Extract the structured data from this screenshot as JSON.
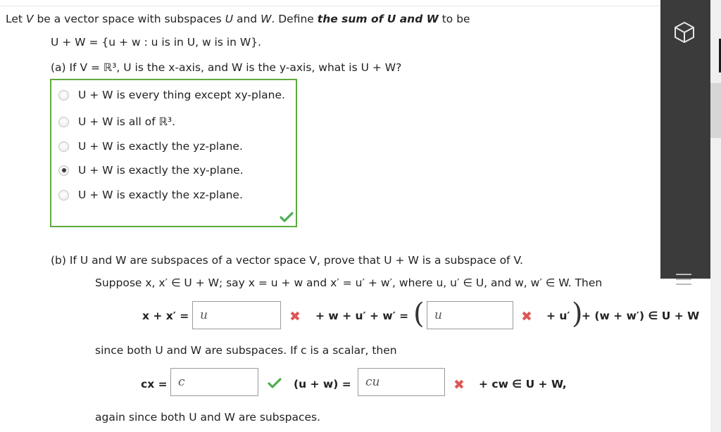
{
  "intro": {
    "prefix": "Let ",
    "V": "V",
    "mid1": " be a vector space with subspaces ",
    "U": "U",
    "and": " and ",
    "W": "W",
    "mid2": ". Define ",
    "bold_def": "the sum of U and W",
    "suffix": " to be"
  },
  "sum_def": "U + W = {u + w : u is in U, w is in W}.",
  "part_a": {
    "question": "(a) If V = ℝ³, U is the x-axis, and W is the y-axis, what is U + W?",
    "options": [
      {
        "label": "U + W is every thing except xy-plane.",
        "selected": false
      },
      {
        "label": "U + W is all of ℝ³.",
        "selected": false
      },
      {
        "label": "U + W is exactly the yz-plane.",
        "selected": false
      },
      {
        "label": "U + W is exactly the xy-plane.",
        "selected": true
      },
      {
        "label": "U + W is exactly the xz-plane.",
        "selected": false
      }
    ],
    "status_icon": "check-icon"
  },
  "part_b": {
    "question": "(b) If U and W are subspaces of a vector space V, prove that U + W is a subspace of V.",
    "suppose": "Suppose x, x′ ∈ U + W; say x = u + w and x′ = u′ + w′, where u, u′ ∈ U, and w, w′ ∈ W. Then",
    "eq1_lhs": "x + x′ =",
    "eq1_input": "u",
    "eq1_mid": "+ w + u′ + w′ =",
    "eq1_input2": "u",
    "eq1_tail_u": "+ u′",
    "eq1_tail": "+ (w + w′) ∈ U + W",
    "since": "since both U and W are subspaces. If c is a scalar, then",
    "eq2_lhs": "cx =",
    "eq2_input": "c",
    "eq2_mid": "(u + w) =",
    "eq2_input2": "cu",
    "eq2_tail": "+ cw ∈ U + W,",
    "again": "again since both U and W are subspaces."
  },
  "colors": {
    "correct_border": "#5faa3c",
    "check": "#4caf50",
    "wrong": "#e05555",
    "panel": "#3b3b3b"
  },
  "icons": {
    "panel_top": "cube-icon",
    "panel_menu": "menu-icon",
    "wrong": "x-mark-icon",
    "right": "check-icon"
  }
}
